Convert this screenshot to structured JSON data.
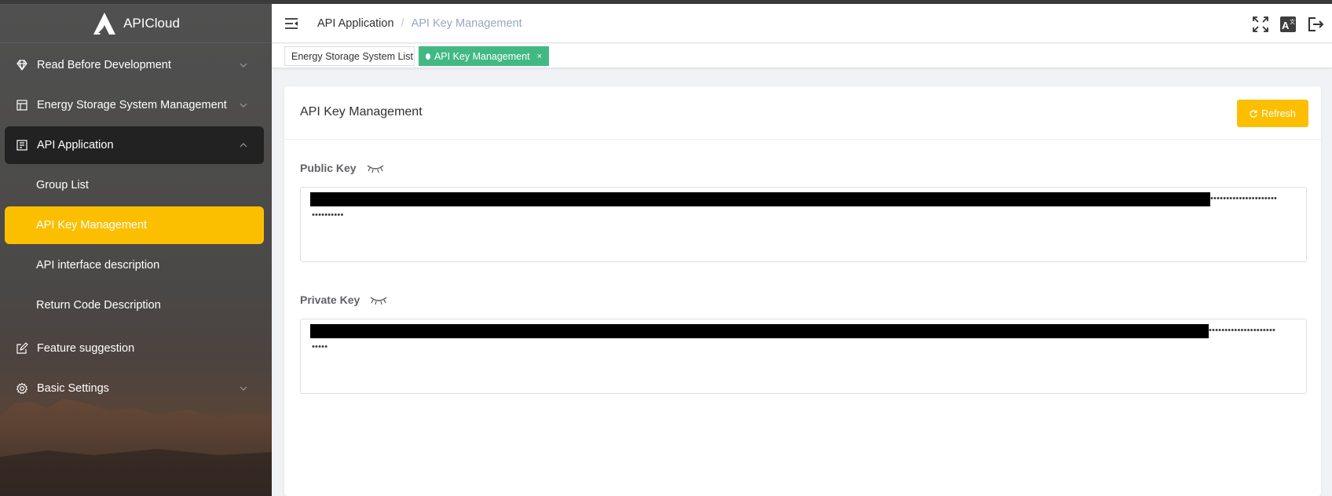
{
  "app": {
    "name": "APICloud"
  },
  "sidebar": {
    "items": [
      {
        "label": "Read Before Development",
        "icon": "diamond-icon",
        "expandable": true,
        "expanded": false
      },
      {
        "label": "Energy Storage System Management",
        "icon": "system-icon",
        "expandable": true,
        "expanded": false
      },
      {
        "label": "API Application",
        "icon": "document-icon",
        "expandable": true,
        "expanded": true,
        "children": [
          {
            "label": "Group List",
            "active": false
          },
          {
            "label": "API Key Management",
            "active": true
          },
          {
            "label": "API interface description",
            "active": false
          },
          {
            "label": "Return Code Description",
            "active": false
          }
        ]
      },
      {
        "label": "Feature suggestion",
        "icon": "edit-icon",
        "expandable": false
      },
      {
        "label": "Basic Settings",
        "icon": "gear-icon",
        "expandable": true,
        "expanded": false
      }
    ]
  },
  "header": {
    "breadcrumb": [
      "API Application",
      "API Key Management"
    ],
    "breadcrumb_separator": "/",
    "icons": [
      "fullscreen-icon",
      "translate-icon",
      "logout-icon"
    ]
  },
  "tags": [
    {
      "label": "Energy Storage System List",
      "active": false
    },
    {
      "label": "API Key Management",
      "active": true,
      "close": "×"
    }
  ],
  "card": {
    "title": "API Key Management",
    "refresh_label": "Refresh",
    "public_key": {
      "label": "Public Key",
      "visible": false,
      "masked_line1": "•••••••••••••••••••••",
      "masked_line2": "••••••••••"
    },
    "private_key": {
      "label": "Private Key",
      "visible": false,
      "masked_line1": "•••••••••••••••••••••",
      "masked_line2": "•••••"
    }
  },
  "colors": {
    "accent": "#fcbf00",
    "tag_active": "#42b983",
    "sidebar_open": "#222222"
  }
}
